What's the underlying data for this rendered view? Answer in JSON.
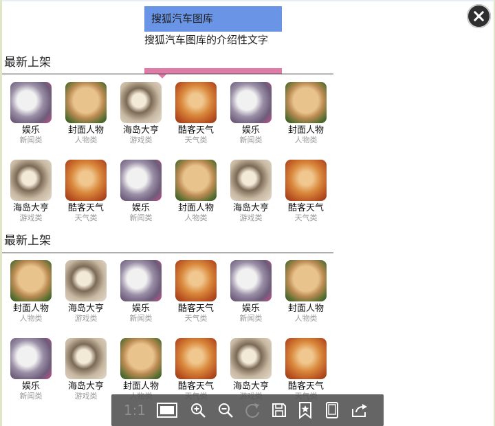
{
  "header": {
    "title": "搜狐汽车图库",
    "subtitle": "搜狐汽车图库的介绍性文字"
  },
  "sections": [
    {
      "title": "最新上架",
      "items": [
        {
          "name": "娱乐",
          "category": "新闻类",
          "image": "gray-cat"
        },
        {
          "name": "封面人物",
          "category": "人物类",
          "image": "kitten"
        },
        {
          "name": "海岛大亨",
          "category": "游戏类",
          "image": "pug"
        },
        {
          "name": "酷客天气",
          "category": "天气类",
          "image": "pomeranian"
        },
        {
          "name": "娱乐",
          "category": "新闻类",
          "image": "gray-cat"
        },
        {
          "name": "封面人物",
          "category": "人物类",
          "image": "kitten"
        },
        {
          "name": "海岛大亨",
          "category": "游戏类",
          "image": "pug"
        },
        {
          "name": "酷客天气",
          "category": "天气类",
          "image": "pomeranian"
        },
        {
          "name": "娱乐",
          "category": "新闻类",
          "image": "gray-cat"
        },
        {
          "name": "封面人物",
          "category": "人物类",
          "image": "kitten"
        },
        {
          "name": "海岛大亨",
          "category": "游戏类",
          "image": "pug"
        },
        {
          "name": "酷客天气",
          "category": "天气类",
          "image": "pomeranian"
        }
      ]
    },
    {
      "title": "最新上架",
      "items": [
        {
          "name": "封面人物",
          "category": "人物类",
          "image": "kitten"
        },
        {
          "name": "海岛大亨",
          "category": "游戏类",
          "image": "pug"
        },
        {
          "name": "娱乐",
          "category": "新闻类",
          "image": "gray-cat"
        },
        {
          "name": "酷客天气",
          "category": "天气类",
          "image": "pomeranian"
        },
        {
          "name": "娱乐",
          "category": "新闻类",
          "image": "gray-cat"
        },
        {
          "name": "封面人物",
          "category": "人物类",
          "image": "kitten"
        },
        {
          "name": "娱乐",
          "category": "新闻类",
          "image": "gray-cat"
        },
        {
          "name": "海岛大亨",
          "category": "游戏类",
          "image": "pug"
        },
        {
          "name": "封面人物",
          "category": "人物类",
          "image": "kitten"
        },
        {
          "name": "酷客天气",
          "category": "天气类",
          "image": "pomeranian"
        },
        {
          "name": "海岛大亨",
          "category": "游戏类",
          "image": "pug"
        },
        {
          "name": "酷客天气",
          "category": "天气类",
          "image": "pomeranian"
        }
      ]
    }
  ],
  "viewer_toolbar": {
    "actual_size_label": "1:1",
    "icons": [
      "fit-screen-icon",
      "zoom-in-icon",
      "zoom-out-icon",
      "rotate-icon",
      "save-icon",
      "bookmark-star-icon",
      "device-icon",
      "share-icon"
    ]
  },
  "colors": {
    "header_bg": "#6a95e6",
    "accent_pink": "#e07aa6",
    "toolbar_bg": "#505050"
  }
}
